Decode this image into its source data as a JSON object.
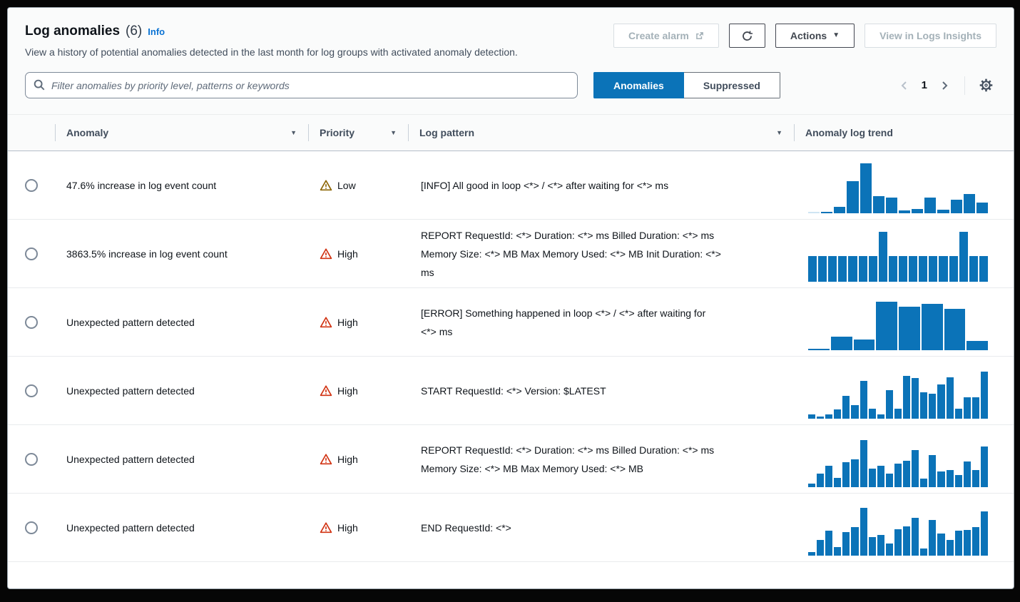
{
  "page": {
    "title": "Log anomalies",
    "count": "(6)",
    "info": "Info",
    "description": "View a history of potential anomalies detected in the last month for log groups with activated anomaly detection."
  },
  "toolbar": {
    "create_alarm": "Create alarm",
    "actions": "Actions",
    "view_insights": "View in Logs Insights"
  },
  "filter": {
    "placeholder": "Filter anomalies by priority level, patterns or keywords"
  },
  "tabs": {
    "anomalies": "Anomalies",
    "suppressed": "Suppressed"
  },
  "pagination": {
    "page": "1"
  },
  "icons": {
    "sort": "▼",
    "caret": "▼"
  },
  "colors": {
    "accent": "#0b73b8",
    "bar": "#0b73b8",
    "bar_muted": "#cfe5f3",
    "link": "#0972d3",
    "priority_low": "#8d6605",
    "priority_high": "#d13212"
  },
  "table": {
    "columns": [
      {
        "label": "Anomaly",
        "sortable": true
      },
      {
        "label": "Priority",
        "sortable": true
      },
      {
        "label": "Log pattern",
        "sortable": true
      },
      {
        "label": "Anomaly log trend",
        "sortable": false
      }
    ],
    "rows": [
      {
        "anomaly": "47.6% increase in log event count",
        "priority": "Low",
        "priority_level": "low",
        "pattern": "[INFO] All good in loop <*> / <*> after waiting for <*> ms",
        "trend": [
          0.02,
          0.03,
          0.12,
          0.62,
          0.97,
          0.33,
          0.31,
          0.05,
          0.09,
          0.31,
          0.07,
          0.26,
          0.37,
          0.21
        ],
        "muted_bars": [
          0
        ]
      },
      {
        "anomaly": "3863.5% increase in log event count",
        "priority": "High",
        "priority_level": "high",
        "pattern": "REPORT RequestId: <*> Duration: <*> ms Billed Duration: <*> ms\nMemory Size: <*> MB Max Memory Used: <*> MB Init Duration: <*>\nms",
        "trend": [
          0.5,
          0.5,
          0.5,
          0.5,
          0.5,
          0.5,
          0.5,
          0.97,
          0.5,
          0.5,
          0.5,
          0.5,
          0.5,
          0.5,
          0.5,
          0.97,
          0.5,
          0.5
        ],
        "muted_bars": []
      },
      {
        "anomaly": "Unexpected pattern detected",
        "priority": "High",
        "priority_level": "high",
        "pattern": "[ERROR] Something happened in loop <*> / <*> after waiting for\n<*> ms",
        "trend": [
          0.02,
          0.26,
          0.21,
          0.95,
          0.85,
          0.9,
          0.8,
          0.18
        ],
        "muted_bars": []
      },
      {
        "anomaly": "Unexpected pattern detected",
        "priority": "High",
        "priority_level": "high",
        "pattern": "START RequestId: <*> Version: $LATEST",
        "trend": [
          0.08,
          0.04,
          0.09,
          0.18,
          0.45,
          0.27,
          0.74,
          0.19,
          0.09,
          0.56,
          0.2,
          0.83,
          0.79,
          0.52,
          0.49,
          0.66,
          0.81,
          0.2,
          0.41,
          0.41,
          0.91
        ],
        "muted_bars": []
      },
      {
        "anomaly": "Unexpected pattern detected",
        "priority": "High",
        "priority_level": "high",
        "pattern": "REPORT RequestId: <*> Duration: <*> ms Billed Duration: <*> ms\nMemory Size: <*> MB Max Memory Used: <*> MB",
        "trend": [
          0.07,
          0.26,
          0.41,
          0.18,
          0.48,
          0.54,
          0.92,
          0.36,
          0.41,
          0.26,
          0.46,
          0.52,
          0.72,
          0.16,
          0.62,
          0.31,
          0.34,
          0.23,
          0.5,
          0.33,
          0.79
        ],
        "muted_bars": []
      },
      {
        "anomaly": "Unexpected pattern detected",
        "priority": "High",
        "priority_level": "high",
        "pattern": "END RequestId: <*>",
        "trend": [
          0.07,
          0.31,
          0.48,
          0.16,
          0.46,
          0.56,
          0.93,
          0.36,
          0.4,
          0.23,
          0.52,
          0.57,
          0.73,
          0.14,
          0.7,
          0.43,
          0.31,
          0.48,
          0.5,
          0.56,
          0.86
        ],
        "muted_bars": []
      }
    ]
  }
}
